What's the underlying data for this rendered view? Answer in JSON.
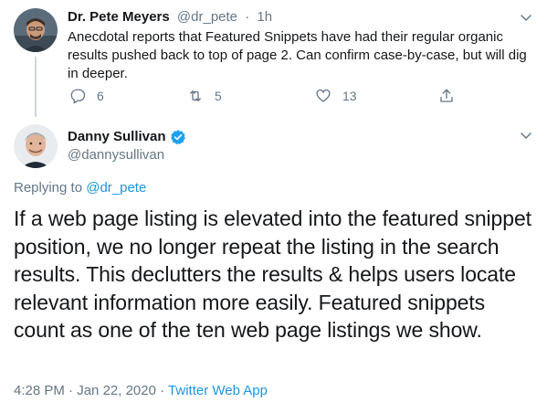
{
  "tweet1": {
    "name": "Dr. Pete Meyers",
    "handle": "@dr_pete",
    "separator": "·",
    "time": "1h",
    "text": "Anecdotal reports that Featured Snippets have had their regular organic results pushed back to top of page 2. Can confirm case-by-case, but will dig in deeper.",
    "replies": "6",
    "retweets": "5",
    "likes": "13"
  },
  "tweet2": {
    "name": "Danny Sullivan",
    "handle": "@dannysullivan",
    "replying_prefix": "Replying to ",
    "replying_to": "@dr_pete",
    "text": "If a web page listing is elevated into the featured snippet position, we no longer repeat the listing in the search results. This declutters the results & helps users locate relevant information more easily. Featured snippets count as one of the ten web page listings we show.",
    "time": "4:28 PM",
    "date_separator": " · ",
    "date": "Jan 22, 2020",
    "source_separator": " · ",
    "source": "Twitter Web App"
  },
  "colors": {
    "text": "#14171a",
    "muted": "#657786",
    "link": "#1b95e0",
    "verified": "#1da1f2",
    "thread_line": "#ccd6dd"
  },
  "icons": [
    "reply-icon",
    "retweet-icon",
    "like-icon",
    "share-icon",
    "chevron-down-icon",
    "verified-badge-icon"
  ]
}
